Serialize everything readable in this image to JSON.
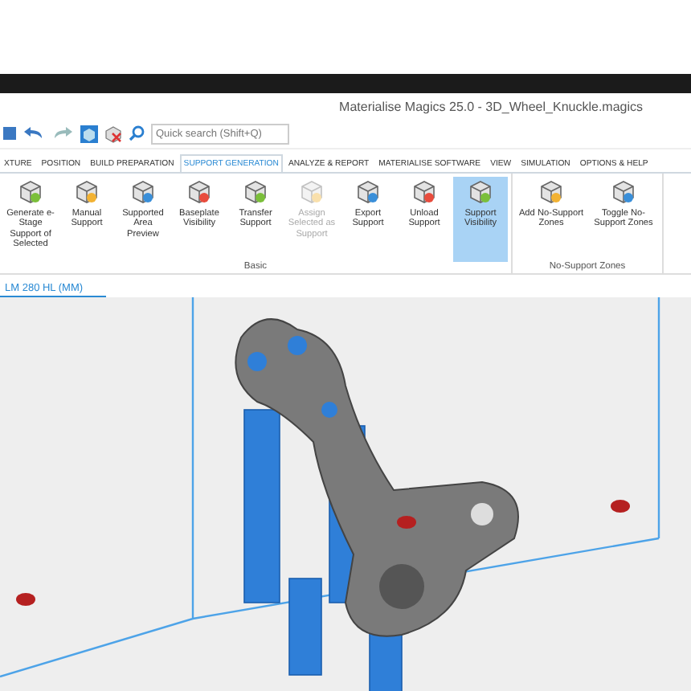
{
  "window": {
    "title": "Materialise Magics 25.0 - 3D_Wheel_Knuckle.magics"
  },
  "quick_access": {
    "search": {
      "placeholder": "Quick search (Shift+Q)"
    }
  },
  "tabs": [
    {
      "label": "XTURE",
      "selected": false
    },
    {
      "label": "POSITION",
      "selected": false
    },
    {
      "label": "BUILD PREPARATION",
      "selected": false
    },
    {
      "label": "SUPPORT GENERATION",
      "selected": true
    },
    {
      "label": "ANALYZE & REPORT",
      "selected": false
    },
    {
      "label": "MATERIALISE SOFTWARE",
      "selected": false
    },
    {
      "label": "VIEW",
      "selected": false
    },
    {
      "label": "SIMULATION",
      "selected": false
    },
    {
      "label": "OPTIONS & HELP",
      "selected": false
    }
  ],
  "ribbon_groups": [
    {
      "label": "Basic",
      "buttons": [
        {
          "label": "Generate e-Stage Support of Selected",
          "selected": false,
          "disabled": false
        },
        {
          "label": "Manual Support",
          "selected": false,
          "disabled": false
        },
        {
          "label": "Supported Area Preview",
          "selected": false,
          "disabled": false
        },
        {
          "label": "Baseplate Visibility",
          "selected": false,
          "disabled": false
        },
        {
          "label": "Transfer Support",
          "selected": false,
          "disabled": false
        },
        {
          "label": "Assign Selected as Support",
          "selected": false,
          "disabled": true
        },
        {
          "label": "Export Support",
          "selected": false,
          "disabled": false
        },
        {
          "label": "Unload Support",
          "selected": false,
          "disabled": false
        },
        {
          "label": "Support Visibility",
          "selected": true,
          "disabled": false
        }
      ]
    },
    {
      "label": "No-Support Zones",
      "buttons": [
        {
          "label": "Add No-Support Zones",
          "selected": false,
          "disabled": false
        },
        {
          "label": "Toggle No-Support Zones",
          "selected": false,
          "disabled": false
        }
      ]
    }
  ],
  "viewport": {
    "tab": "LM 280 HL (MM)"
  }
}
